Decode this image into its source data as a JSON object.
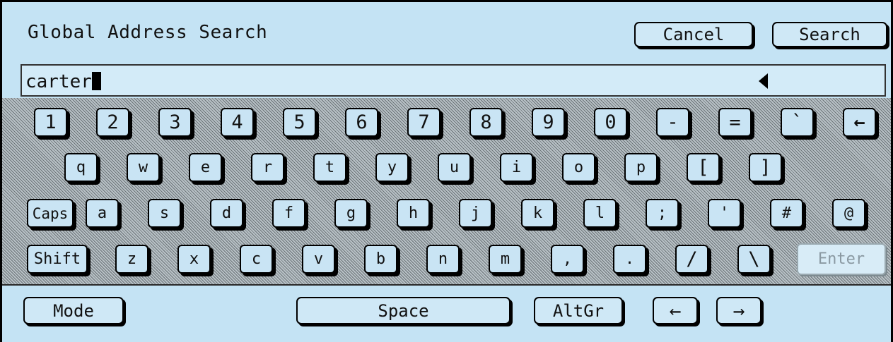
{
  "header": {
    "title": "Global Address Search",
    "cancel_label": "Cancel",
    "search_label": "Search"
  },
  "input": {
    "value": "carter"
  },
  "keys": {
    "row1": [
      "1",
      "2",
      "3",
      "4",
      "5",
      "6",
      "7",
      "8",
      "9",
      "0",
      "-",
      "=",
      "`",
      "←"
    ],
    "row2": [
      "q",
      "w",
      "e",
      "r",
      "t",
      "y",
      "u",
      "i",
      "o",
      "p",
      "[",
      "]"
    ],
    "row3": [
      "Caps",
      "a",
      "s",
      "d",
      "f",
      "g",
      "h",
      "j",
      "k",
      "l",
      ";",
      "'",
      "#",
      "@"
    ],
    "row4": [
      "Shift",
      "z",
      "x",
      "c",
      "v",
      "b",
      "n",
      "m",
      ",",
      ".",
      "/",
      "\\",
      "Enter"
    ]
  },
  "bottom": {
    "mode_label": "Mode",
    "space_label": "Space",
    "altgr_label": "AltGr",
    "left_arrow": "←",
    "right_arrow": "→"
  }
}
